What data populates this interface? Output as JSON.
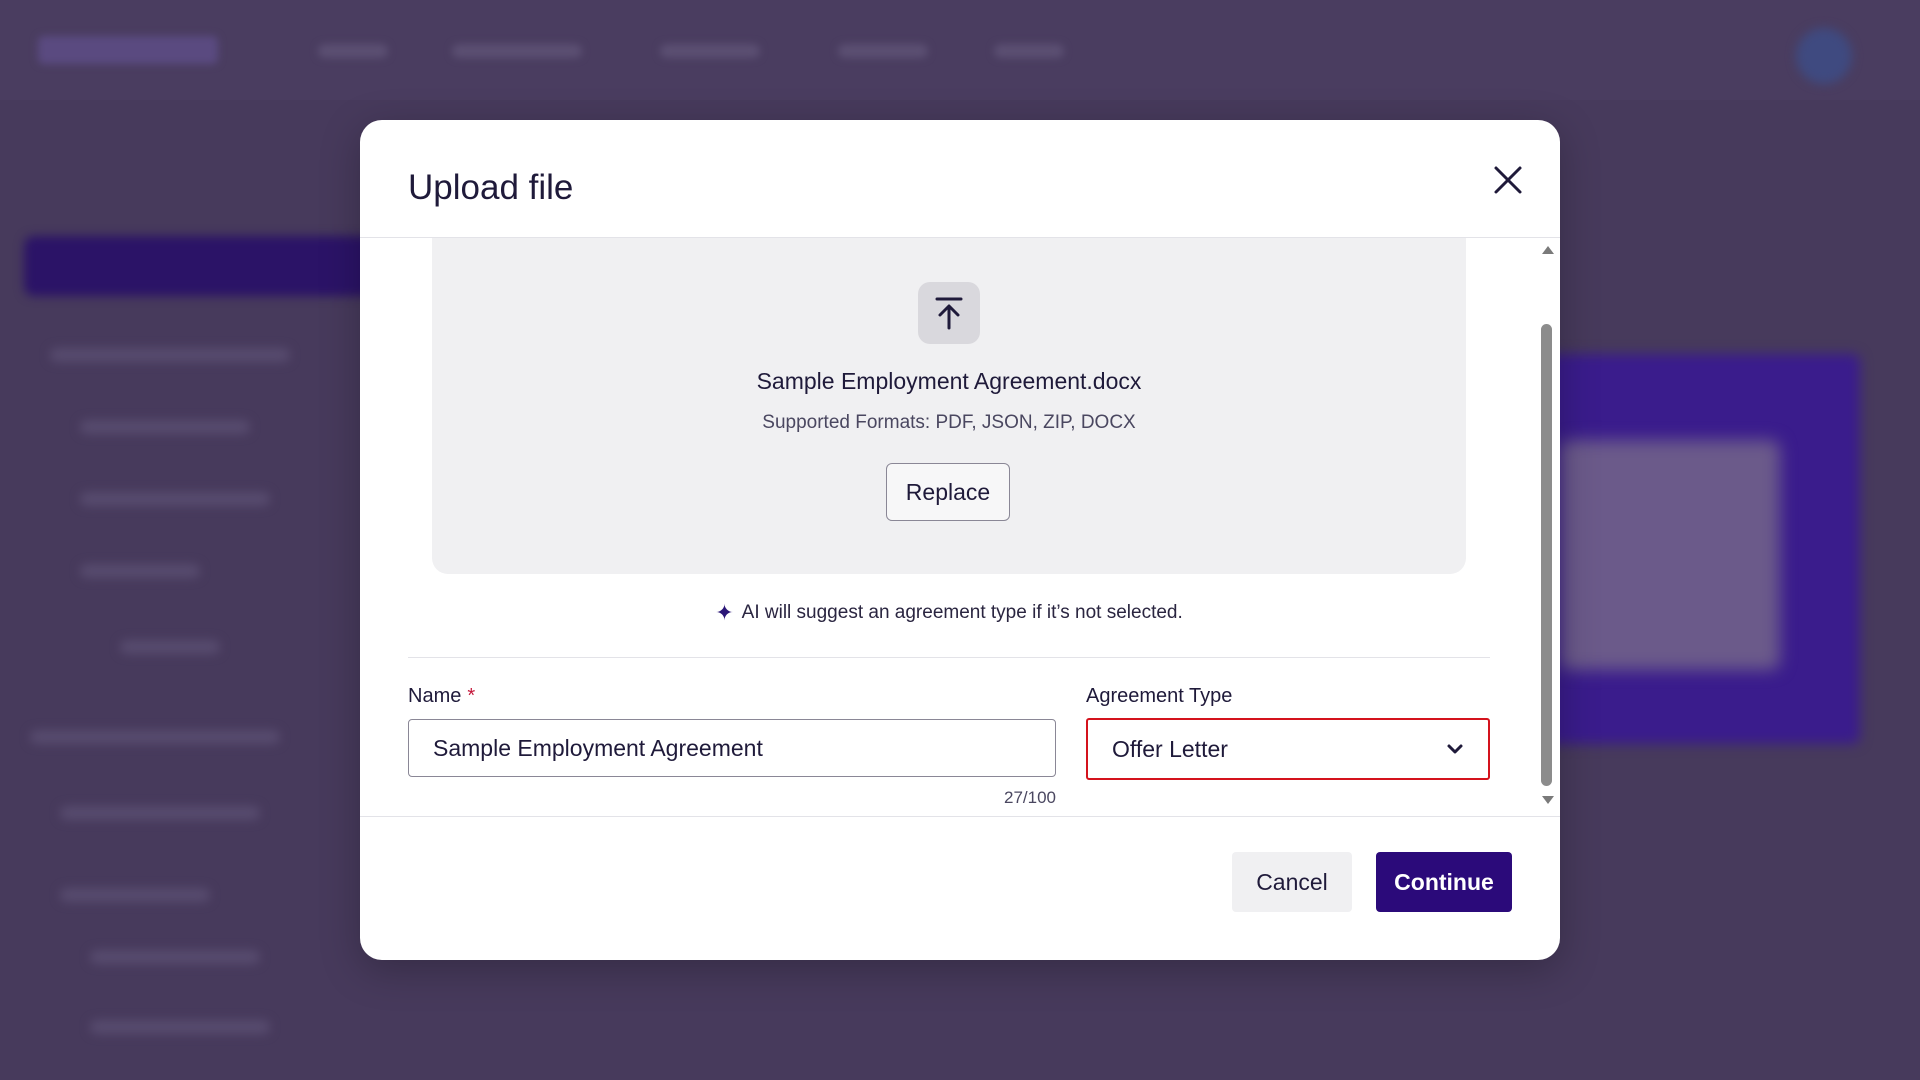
{
  "modal": {
    "title": "Upload file",
    "dropzone": {
      "file_name": "Sample Employment Agreement.docx",
      "supported_formats": "Supported Formats: PDF, JSON, ZIP, DOCX",
      "replace_label": "Replace",
      "upload_icon": "upload-arrow-icon"
    },
    "ai_hint": "AI will suggest an agreement type if it’s not selected.",
    "form": {
      "name_label": "Name",
      "name_required_marker": "*",
      "name_value": "Sample Employment Agreement",
      "name_char_count": "27/100",
      "agreement_type_label": "Agreement Type",
      "agreement_type_value": "Offer Letter"
    },
    "footer": {
      "cancel_label": "Cancel",
      "continue_label": "Continue"
    }
  },
  "colors": {
    "primary": "#2b0a7a",
    "error_outline": "#d4131d",
    "required": "#c4173a",
    "backdrop": "#473a5c"
  }
}
